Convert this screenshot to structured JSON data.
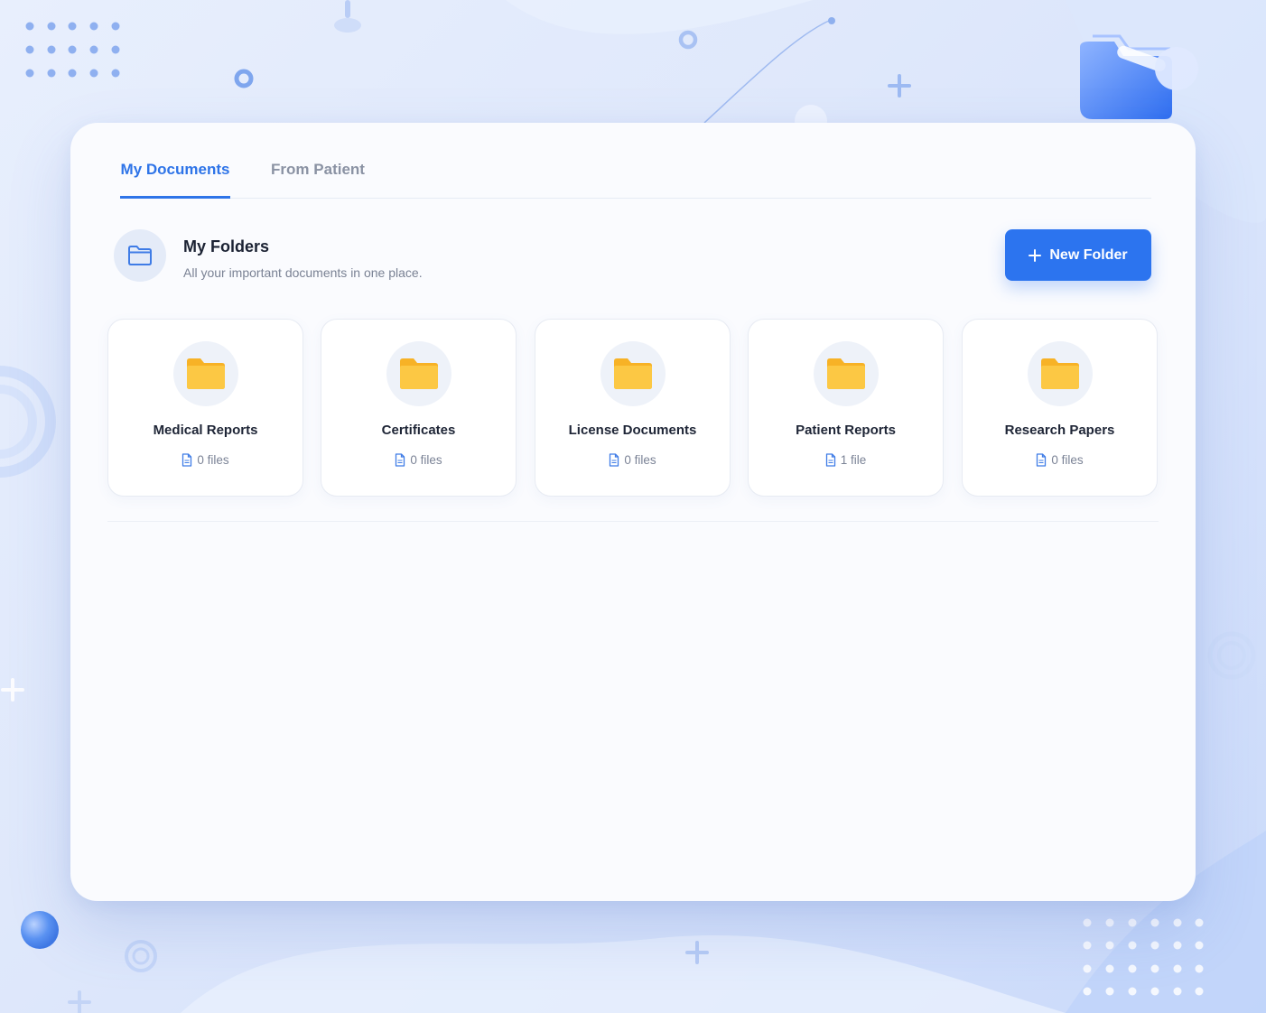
{
  "tabs": [
    {
      "label": "My Documents",
      "active": true
    },
    {
      "label": "From Patient",
      "active": false
    }
  ],
  "header": {
    "title": "My Folders",
    "subtitle": "All your important documents in one place.",
    "icon": "folder-outline-icon"
  },
  "new_folder_button": {
    "label": "New Folder",
    "icon": "plus-icon"
  },
  "folders": [
    {
      "name": "Medical Reports",
      "count": "0 files"
    },
    {
      "name": "Certificates",
      "count": "0 files"
    },
    {
      "name": "License Documents",
      "count": "0 files"
    },
    {
      "name": "Patient Reports",
      "count": "1 file"
    },
    {
      "name": "Research Papers",
      "count": "0 files"
    }
  ],
  "colors": {
    "accent": "#2e74e8",
    "button": "#2c74ef",
    "folder": "#fbbf24",
    "text_dark": "#1b2233",
    "text_muted": "#7a8294"
  }
}
